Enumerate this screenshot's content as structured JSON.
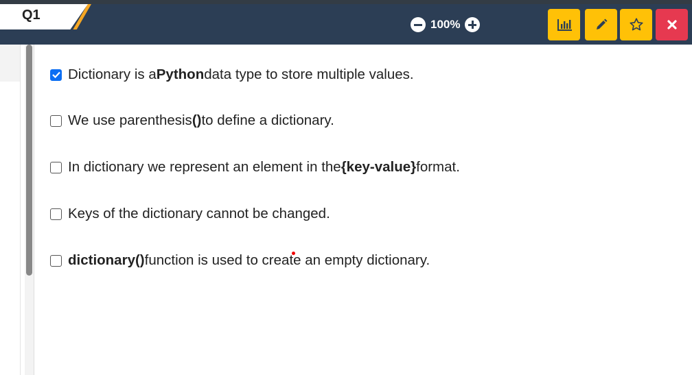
{
  "tab": {
    "label": "Q1"
  },
  "zoom": {
    "level": "100%"
  },
  "toolbar": {
    "stats": "stats-icon",
    "edit": "pencil-icon",
    "favorite": "star-icon",
    "close": "close-icon"
  },
  "colors": {
    "header": "#2c3e55",
    "accent": "#f5a623",
    "tool": "#ffc107",
    "close": "#e63950",
    "check": "#0b6ef3"
  },
  "options": [
    {
      "checked": true,
      "pre": "Dictionary is a ",
      "bold": "Python",
      "post": " data type to store multiple values."
    },
    {
      "checked": false,
      "pre": "We use parenthesis ",
      "bold": "()",
      "post": " to define a dictionary."
    },
    {
      "checked": false,
      "pre": "In dictionary we represent an element in the ",
      "bold": "{key-value}",
      "post": " format."
    },
    {
      "checked": true,
      "pre": "Keys of the dictionary cannot be changed.",
      "bold": "",
      "post": ""
    },
    {
      "checked": false,
      "pre": "",
      "bold": "dictionary()",
      "post": " function is used to create an empty dictionary."
    }
  ]
}
